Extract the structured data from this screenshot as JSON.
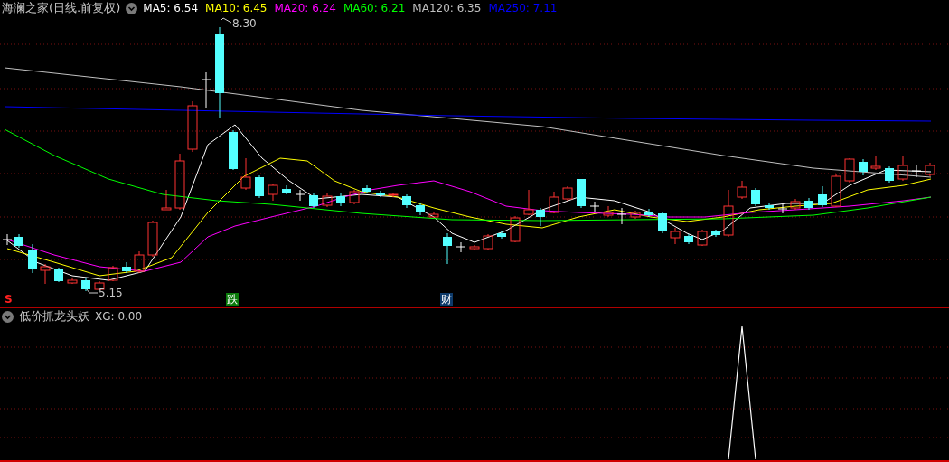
{
  "chart": {
    "title": "海澜之家(日线.前复权)",
    "indicators": [
      {
        "label": "MA5: 6.54",
        "color": "#ffffff"
      },
      {
        "label": "MA10: 6.45",
        "color": "#ffff00"
      },
      {
        "label": "MA20: 6.24",
        "color": "#ff00ff"
      },
      {
        "label": "MA60: 6.21",
        "color": "#00ff00"
      },
      {
        "label": "MA120: 6.35",
        "color": "#c0c0c0"
      },
      {
        "label": "MA250: 7.11",
        "color": "#0000ff"
      }
    ],
    "high_label": "8.30",
    "low_label": "5.15",
    "markers": [
      {
        "kind": "signal",
        "text": "S"
      },
      {
        "kind": "fall",
        "text": "跌"
      },
      {
        "kind": "finance",
        "text": "财"
      }
    ]
  },
  "indicator_panel": {
    "title": "低价抓龙头妖",
    "value": "XG: 0.00"
  }
}
